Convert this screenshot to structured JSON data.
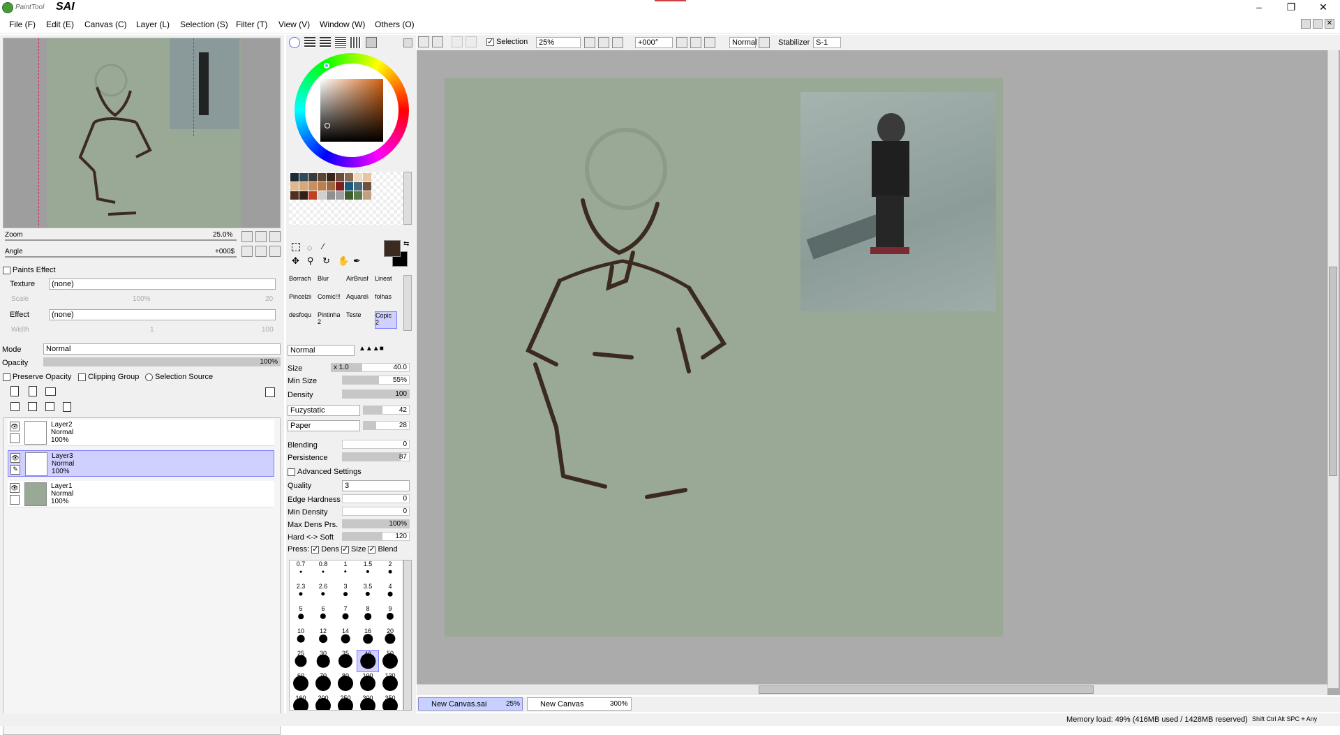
{
  "app": {
    "logo_small": "PaintTool",
    "logo_big": "SAI"
  },
  "menu": [
    "File (F)",
    "Edit (E)",
    "Canvas (C)",
    "Layer (L)",
    "Selection (S)",
    "Filter (T)",
    "View (V)",
    "Window (W)",
    "Others (O)"
  ],
  "navigator": {
    "zoom_label": "Zoom",
    "zoom_value": "25.0%",
    "angle_label": "Angle",
    "angle_value": "+000$"
  },
  "paints_effect": {
    "header": "Paints Effect",
    "texture_label": "Texture",
    "texture_value": "(none)",
    "scale_label": "Scale",
    "scale_value": "100%",
    "scale_value2": "20",
    "effect_label": "Effect",
    "effect_value": "(none)",
    "width_label": "Width",
    "width_value": "1",
    "width_value2": "100"
  },
  "layer_props": {
    "mode_label": "Mode",
    "mode_value": "Normal",
    "opacity_label": "Opacity",
    "opacity_value": "100%",
    "preserve_opacity": "Preserve Opacity",
    "clipping_group": "Clipping Group",
    "selection_source": "Selection Source"
  },
  "layers": [
    {
      "name": "Layer2",
      "mode": "Normal",
      "opacity": "100%",
      "selected": false
    },
    {
      "name": "Layer3",
      "mode": "Normal",
      "opacity": "100%",
      "selected": true
    },
    {
      "name": "Layer1",
      "mode": "Normal",
      "opacity": "100%",
      "selected": false
    }
  ],
  "tools": [
    {
      "label": "Borracha",
      "sub": ""
    },
    {
      "label": "Blur",
      "sub": ""
    },
    {
      "label": "AirBrush",
      "sub": ""
    },
    {
      "label": "Lineat",
      "sub": ""
    },
    {
      "label": "Pincelzin",
      "sub": ""
    },
    {
      "label": "Comic!!!!",
      "sub": ""
    },
    {
      "label": "Aquarela",
      "sub": ""
    },
    {
      "label": "folhas",
      "sub": ""
    },
    {
      "label": "desfoque",
      "sub": ""
    },
    {
      "label": "Pintinhas",
      "sub": "2"
    },
    {
      "label": "Teste",
      "sub": ""
    },
    {
      "label": "Copic",
      "sub": "2"
    }
  ],
  "brush": {
    "blend_mode": "Normal",
    "size_label": "Size",
    "size_mult": "x 1.0",
    "size_value": "40.0",
    "min_size_label": "Min Size",
    "min_size_value": "55%",
    "density_label": "Density",
    "density_value": "100",
    "shape_value": "Fuzystatic",
    "shape_num": "42",
    "texture_value": "Paper",
    "texture_num": "28",
    "blending_label": "Blending",
    "blending_value": "0",
    "persistence_label": "Persistence",
    "persistence_value": "87",
    "advanced_label": "Advanced Settings",
    "quality_label": "Quality",
    "quality_value": "3",
    "edge_label": "Edge Hardness",
    "edge_value": "0",
    "min_density_label": "Min Density",
    "min_density_value": "0",
    "max_dens_label": "Max Dens Prs.",
    "max_dens_value": "100%",
    "hard_soft_label": "Hard <-> Soft",
    "hard_soft_value": "120",
    "press_label": "Press:",
    "press_dens": "Dens",
    "press_size": "Size",
    "press_blend": "Blend"
  },
  "brush_sizes": [
    "0.7",
    "0.8",
    "1",
    "1.5",
    "2",
    "2.3",
    "2.6",
    "3",
    "3.5",
    "4",
    "5",
    "6",
    "7",
    "8",
    "9",
    "10",
    "12",
    "14",
    "16",
    "20",
    "25",
    "30",
    "35",
    "40",
    "50",
    "60",
    "70",
    "80",
    "100",
    "120",
    "160",
    "200",
    "250",
    "300",
    "350"
  ],
  "toolbar": {
    "selection_label": "Selection",
    "zoom_value": "25%",
    "angle_value": "+000°",
    "blend_value": "Normal",
    "stabilizer_label": "Stabilizer",
    "stabilizer_value": "S-1"
  },
  "tabs": [
    {
      "name": "New Canvas.sai",
      "zoom": "25%",
      "active": true
    },
    {
      "name": "New Canvas",
      "zoom": "300%",
      "active": false
    }
  ],
  "status": {
    "memory": "Memory load: 49% (416MB used / 1428MB reserved)",
    "keys": "Shift Ctrl Alt SPC ⌖ Any"
  },
  "colors": {
    "canvas_bg": "#9aa896",
    "stroke": "#3a2a20",
    "selected_layer": "#d0d0ff",
    "workspace": "#ababab"
  },
  "swatches": [
    "#1c2b3a",
    "#2e4a5c",
    "#3b3b3b",
    "#5b4636",
    "#3a2618",
    "#6b4e3a",
    "#8a6a50",
    "#f0d7c0",
    "#e8c4a0",
    "#e0b890",
    "#d4a878",
    "#c89060",
    "#b8804e",
    "#a06840",
    "#7a2020",
    "#1a5a7a",
    "#4a6a7a",
    "#705040",
    "#503020",
    "#302018",
    "#c04020",
    "#d0d0d0",
    "#909090",
    "#a0a0a0",
    "#3d5d2d",
    "#5a7a4a",
    "#c0a080"
  ]
}
